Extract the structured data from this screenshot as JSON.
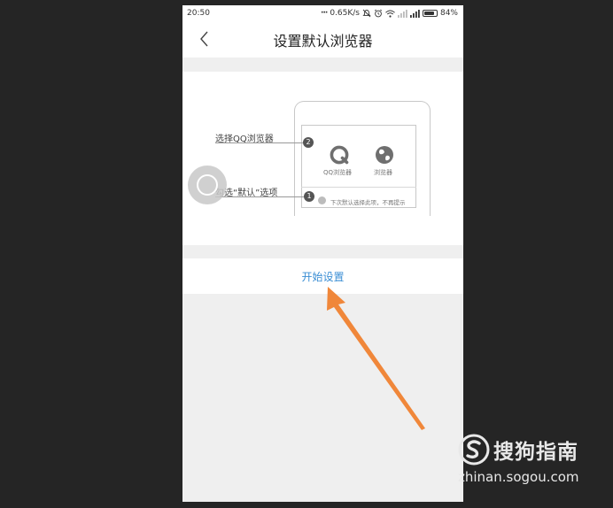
{
  "status_bar": {
    "time": "20:50",
    "network_speed": "0.65K/s",
    "battery": "84%",
    "battery_level": 0.84,
    "icons": [
      "dots-icon",
      "mute-icon",
      "alarm-icon",
      "wifi-icon",
      "signal-icon",
      "signal-icon",
      "battery-icon"
    ]
  },
  "header": {
    "title": "设置默认浏览器",
    "back_icon": "chevron-left-icon"
  },
  "illustration": {
    "step2_badge": "2",
    "step2_text": "选择QQ浏览器",
    "step1_badge": "1",
    "step1_text": "勾选“默认”选项",
    "app1_label": "QQ浏览器",
    "app2_label": "浏览器",
    "option_text": "下次默认选择此项，不再提示",
    "app1_icon": "qq-browser-icon",
    "app2_icon": "globe-browser-icon"
  },
  "actions": {
    "start_label": "开始设置"
  },
  "overlay": {
    "arrow_color": "#f0873a"
  },
  "watermark": {
    "brand": "搜狗指南",
    "url": "zhinan.sogou.com"
  },
  "colors": {
    "accent": "#3a8ed4",
    "background": "#efefef",
    "outer": "#252525"
  }
}
